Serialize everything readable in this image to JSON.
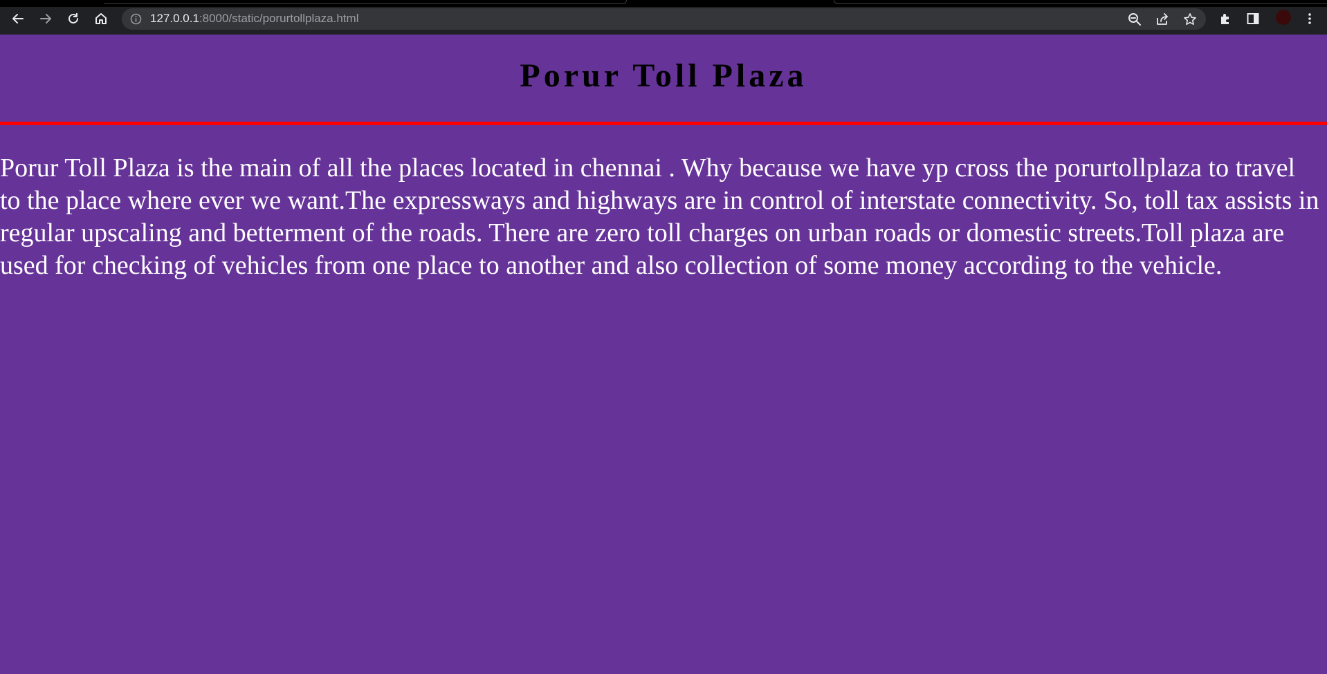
{
  "browser": {
    "url_host": "127.0.0.1",
    "url_path": ":8000/static/porurtollplaza.html"
  },
  "page": {
    "title": "Porur Toll Plaza",
    "body": "Porur Toll Plaza is the main of all the places located in chennai . Why because we have yp cross the porurtollplaza to travel to the place where ever we want.The expressways and highways are in control of interstate connectivity. So, toll tax assists in regular upscaling and betterment of the roads. There are zero toll charges on urban roads or domestic streets.Toll plaza are used for checking of vehicles from one place to another and also collection of some money according to the vehicle."
  },
  "colors": {
    "page_background": "#663399",
    "divider": "#ff0000",
    "title_text": "#000000",
    "body_text": "#ffffff"
  }
}
